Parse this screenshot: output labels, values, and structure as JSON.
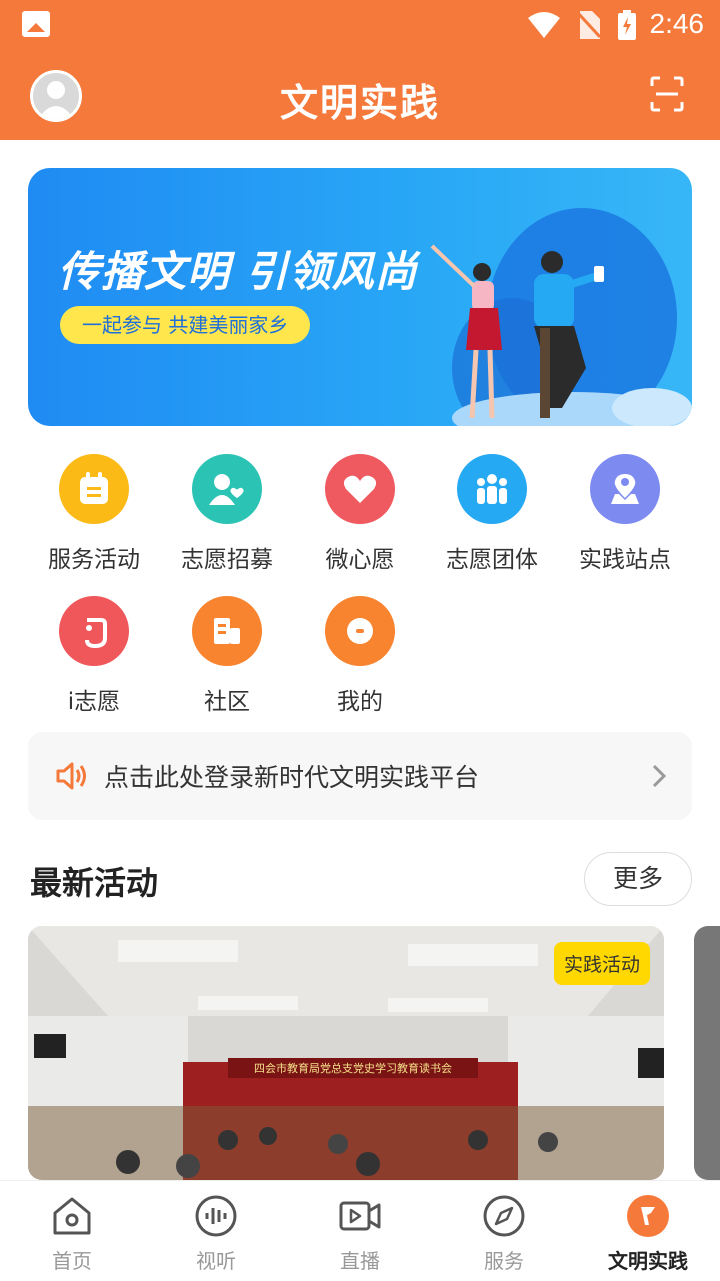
{
  "status_bar": {
    "time": "2:46"
  },
  "header": {
    "title": "文明实践"
  },
  "banner": {
    "headline": "传播文明 引领风尚",
    "slogan": "一起参与 共建美丽家乡"
  },
  "grid": [
    {
      "label": "服务活动",
      "icon": "calendar-icon",
      "color": "#FBBA16"
    },
    {
      "label": "志愿招募",
      "icon": "volunteer-icon",
      "color": "#2BC3B3"
    },
    {
      "label": "微心愿",
      "icon": "heart-icon",
      "color": "#EF5A61"
    },
    {
      "label": "志愿团体",
      "icon": "group-icon",
      "color": "#25A9F2"
    },
    {
      "label": "实践站点",
      "icon": "location-icon",
      "color": "#7D8BF1"
    },
    {
      "label": "i志愿",
      "icon": "i-volunteer-icon",
      "color": "#F0575A"
    },
    {
      "label": "社区",
      "icon": "building-icon",
      "color": "#F88430"
    },
    {
      "label": "我的",
      "icon": "mine-icon",
      "color": "#F88430"
    }
  ],
  "notice": {
    "text": "点击此处登录新时代文明实践平台"
  },
  "latest": {
    "title": "最新活动",
    "more_label": "更多",
    "cards": [
      {
        "tag": "实践活动",
        "banner_text": "四会市教育局党总支党史学习教育读书会"
      }
    ]
  },
  "bottom_nav": [
    {
      "label": "首页",
      "icon": "home-icon",
      "active": false
    },
    {
      "label": "视听",
      "icon": "audio-icon",
      "active": false
    },
    {
      "label": "直播",
      "icon": "live-video-icon",
      "active": false
    },
    {
      "label": "服务",
      "icon": "compass-icon",
      "active": false
    },
    {
      "label": "文明实践",
      "icon": "flag-icon",
      "active": true
    }
  ],
  "colors": {
    "brand": "#F4793B",
    "banner_blue": "#1F8BF3",
    "tag_yellow": "#FFD800"
  }
}
